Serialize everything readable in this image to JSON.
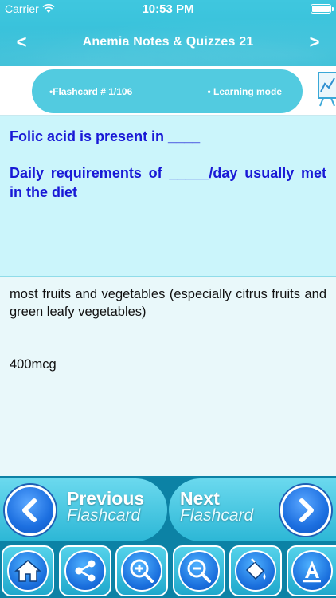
{
  "status_bar": {
    "carrier": "Carrier",
    "time": "10:53 PM",
    "wifi_icon": "wifi-icon",
    "battery_icon": "battery-icon"
  },
  "nav": {
    "title": "Anemia Notes & Quizzes 21",
    "back_label": "<",
    "forward_label": ">"
  },
  "info": {
    "flashcard_label": "•Flashcard #  1/106",
    "mode_label": "• Learning mode"
  },
  "question": {
    "line1": "Folic acid is present in ____",
    "line2": "Daily requirements of _____/day usually met in the diet"
  },
  "answer": {
    "line1": "most fruits and vegetables (especially citrus fruits and green leafy vegetables)",
    "line2": "400mcg"
  },
  "flash_nav": {
    "previous_main": "Previous",
    "previous_sub": "Flashcard",
    "next_main": "Next",
    "next_sub": "Flashcard"
  },
  "toolbar": {
    "icons": [
      "home-icon",
      "share-icon",
      "zoom-in-icon",
      "zoom-out-icon",
      "paint-bucket-icon",
      "font-icon"
    ]
  },
  "colors": {
    "header": "#3fc7df",
    "question_text": "#1919d6",
    "question_bg": "#cbf5fb",
    "answer_bg": "#e9f8fa",
    "bar_bg": "#0c82a5",
    "button_blue": "#1c6fe0"
  }
}
